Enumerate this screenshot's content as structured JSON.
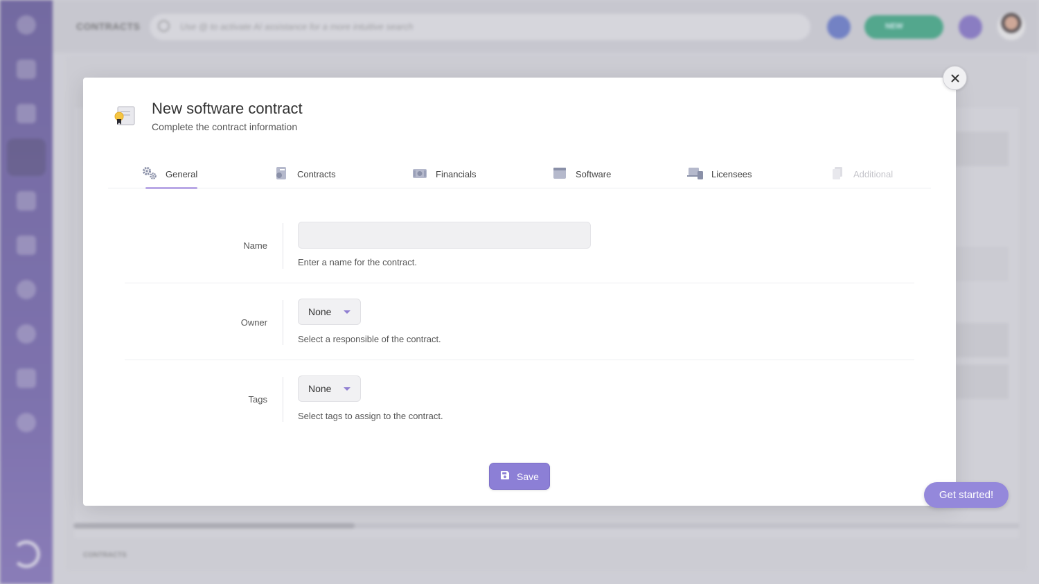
{
  "background": {
    "page_title": "CONTRACTS",
    "search_placeholder": "Use @ to activate AI assistance for a more intuitive search",
    "new_button_label": "NEW",
    "footer_label": "CONTRACTS"
  },
  "modal": {
    "title": "New software contract",
    "subtitle": "Complete the contract information",
    "tabs": [
      {
        "label": "General",
        "icon": "gears-icon",
        "active": true,
        "disabled": false
      },
      {
        "label": "Contracts",
        "icon": "contract-icon",
        "active": false,
        "disabled": false
      },
      {
        "label": "Financials",
        "icon": "money-icon",
        "active": false,
        "disabled": false
      },
      {
        "label": "Software",
        "icon": "window-icon",
        "active": false,
        "disabled": false
      },
      {
        "label": "Licensees",
        "icon": "devices-icon",
        "active": false,
        "disabled": false
      },
      {
        "label": "Additional",
        "icon": "copy-icon",
        "active": false,
        "disabled": true
      }
    ],
    "fields": {
      "name": {
        "label": "Name",
        "value": "",
        "help": "Enter a name for the contract."
      },
      "owner": {
        "label": "Owner",
        "value": "None",
        "help": "Select a responsible of the contract."
      },
      "tags": {
        "label": "Tags",
        "value": "None",
        "help": "Select tags to assign to the contract."
      }
    },
    "save_label": "Save"
  },
  "get_started_label": "Get started!",
  "colors": {
    "accent": "#8c7fd6",
    "sidebar": "#5b4e96",
    "tab_underline": "#b9a8e6",
    "new_button": "#2ea27a"
  }
}
